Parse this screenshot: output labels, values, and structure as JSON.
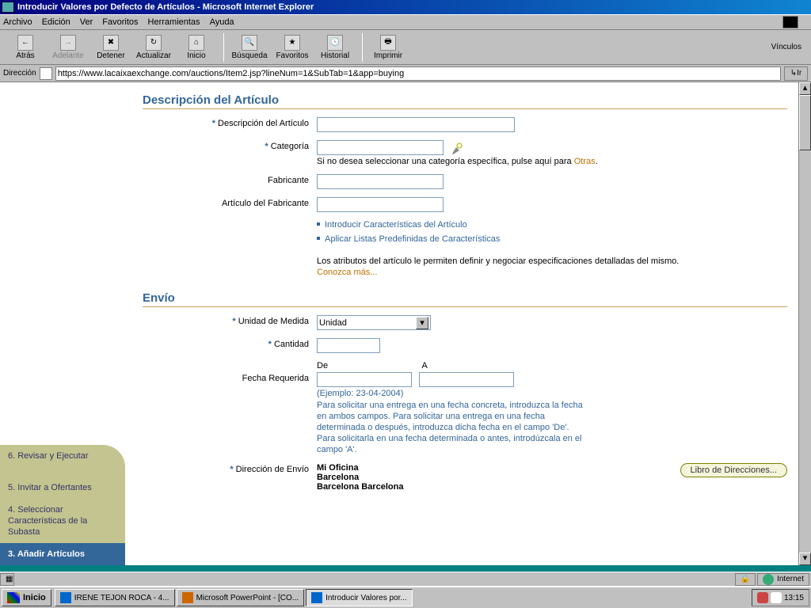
{
  "window_title": "Introducir Valores por Defecto de Artículos - Microsoft Internet Explorer",
  "menu": {
    "archivo": "Archivo",
    "edicion": "Edición",
    "ver": "Ver",
    "favoritos": "Favoritos",
    "herramientas": "Herramientas",
    "ayuda": "Ayuda"
  },
  "tb": {
    "atras": "Atrás",
    "adelante": "Adelante",
    "detener": "Detener",
    "actualizar": "Actualizar",
    "inicio": "Inicio",
    "busqueda": "Búsqueda",
    "favoritos": "Favoritos",
    "historial": "Historial",
    "imprimir": "Imprimir",
    "vinculos": "Vínculos"
  },
  "addr": {
    "label": "Dirección",
    "url": "https://www.lacaixaexchange.com/auctions/Item2.jsp?lineNum=1&SubTab=1&app=buying",
    "go": "Ir"
  },
  "sidebar": {
    "items": [
      {
        "label": "3. Añadir Artículos"
      },
      {
        "label": "4. Seleccionar Características de la Subasta"
      },
      {
        "label": "5. Invitar a Ofertantes"
      },
      {
        "label": "6. Revisar y Ejecutar"
      }
    ]
  },
  "sect1_title": "Descripción del Artículo",
  "labels": {
    "descripcion": "Descripción del Artículo",
    "categoria": "Categoría",
    "cat_hint_pre": "Si no desea seleccionar una categoría específica, pulse aquí para ",
    "cat_hint_link": "Otras",
    "fabricante": "Fabricante",
    "art_fab": "Artículo del Fabricante",
    "link1": "Introducir Características del Artículo",
    "link2": "Aplicar Listas Predefinidas de Características",
    "attr_text": "Los atributos del artículo le permiten definir y negociar especificaciones detalladas del mismo.",
    "conozca": "Conozca más...",
    "unidad": "Unidad de Medida",
    "unidad_val": "Unidad",
    "cantidad": "Cantidad",
    "de": "De",
    "a": "A",
    "fecha": "Fecha Requerida",
    "ejemplo": "(Ejemplo: 23-04-2004)",
    "help1": "Para solicitar una entrega en una fecha concreta, introduzca la fecha",
    "help2": "en ambos campos. Para solicitar una entrega en una fecha",
    "help3": "determinada o después, introduzca dicha fecha en el campo 'De'.",
    "help4": "Para solicitarla en una fecha determinada o antes, introdúzcala en el",
    "help5": "campo 'A'.",
    "dir_envio": "Dirección de Envío",
    "env_l1": "Mi Oficina",
    "env_l2": "Barcelona",
    "env_l3": "Barcelona  Barcelona",
    "libro": "Libro de Direcciones..."
  },
  "sect2_title": "Envío",
  "status": {
    "zone": "Internet"
  },
  "taskbar": {
    "inicio": "Inicio",
    "t1": "IRENE TEJON ROCA - 4...",
    "t2": "Microsoft PowerPoint - [CO...",
    "t3": "Introducir Valores por...",
    "clock": "13:15"
  },
  "chart_data": null
}
